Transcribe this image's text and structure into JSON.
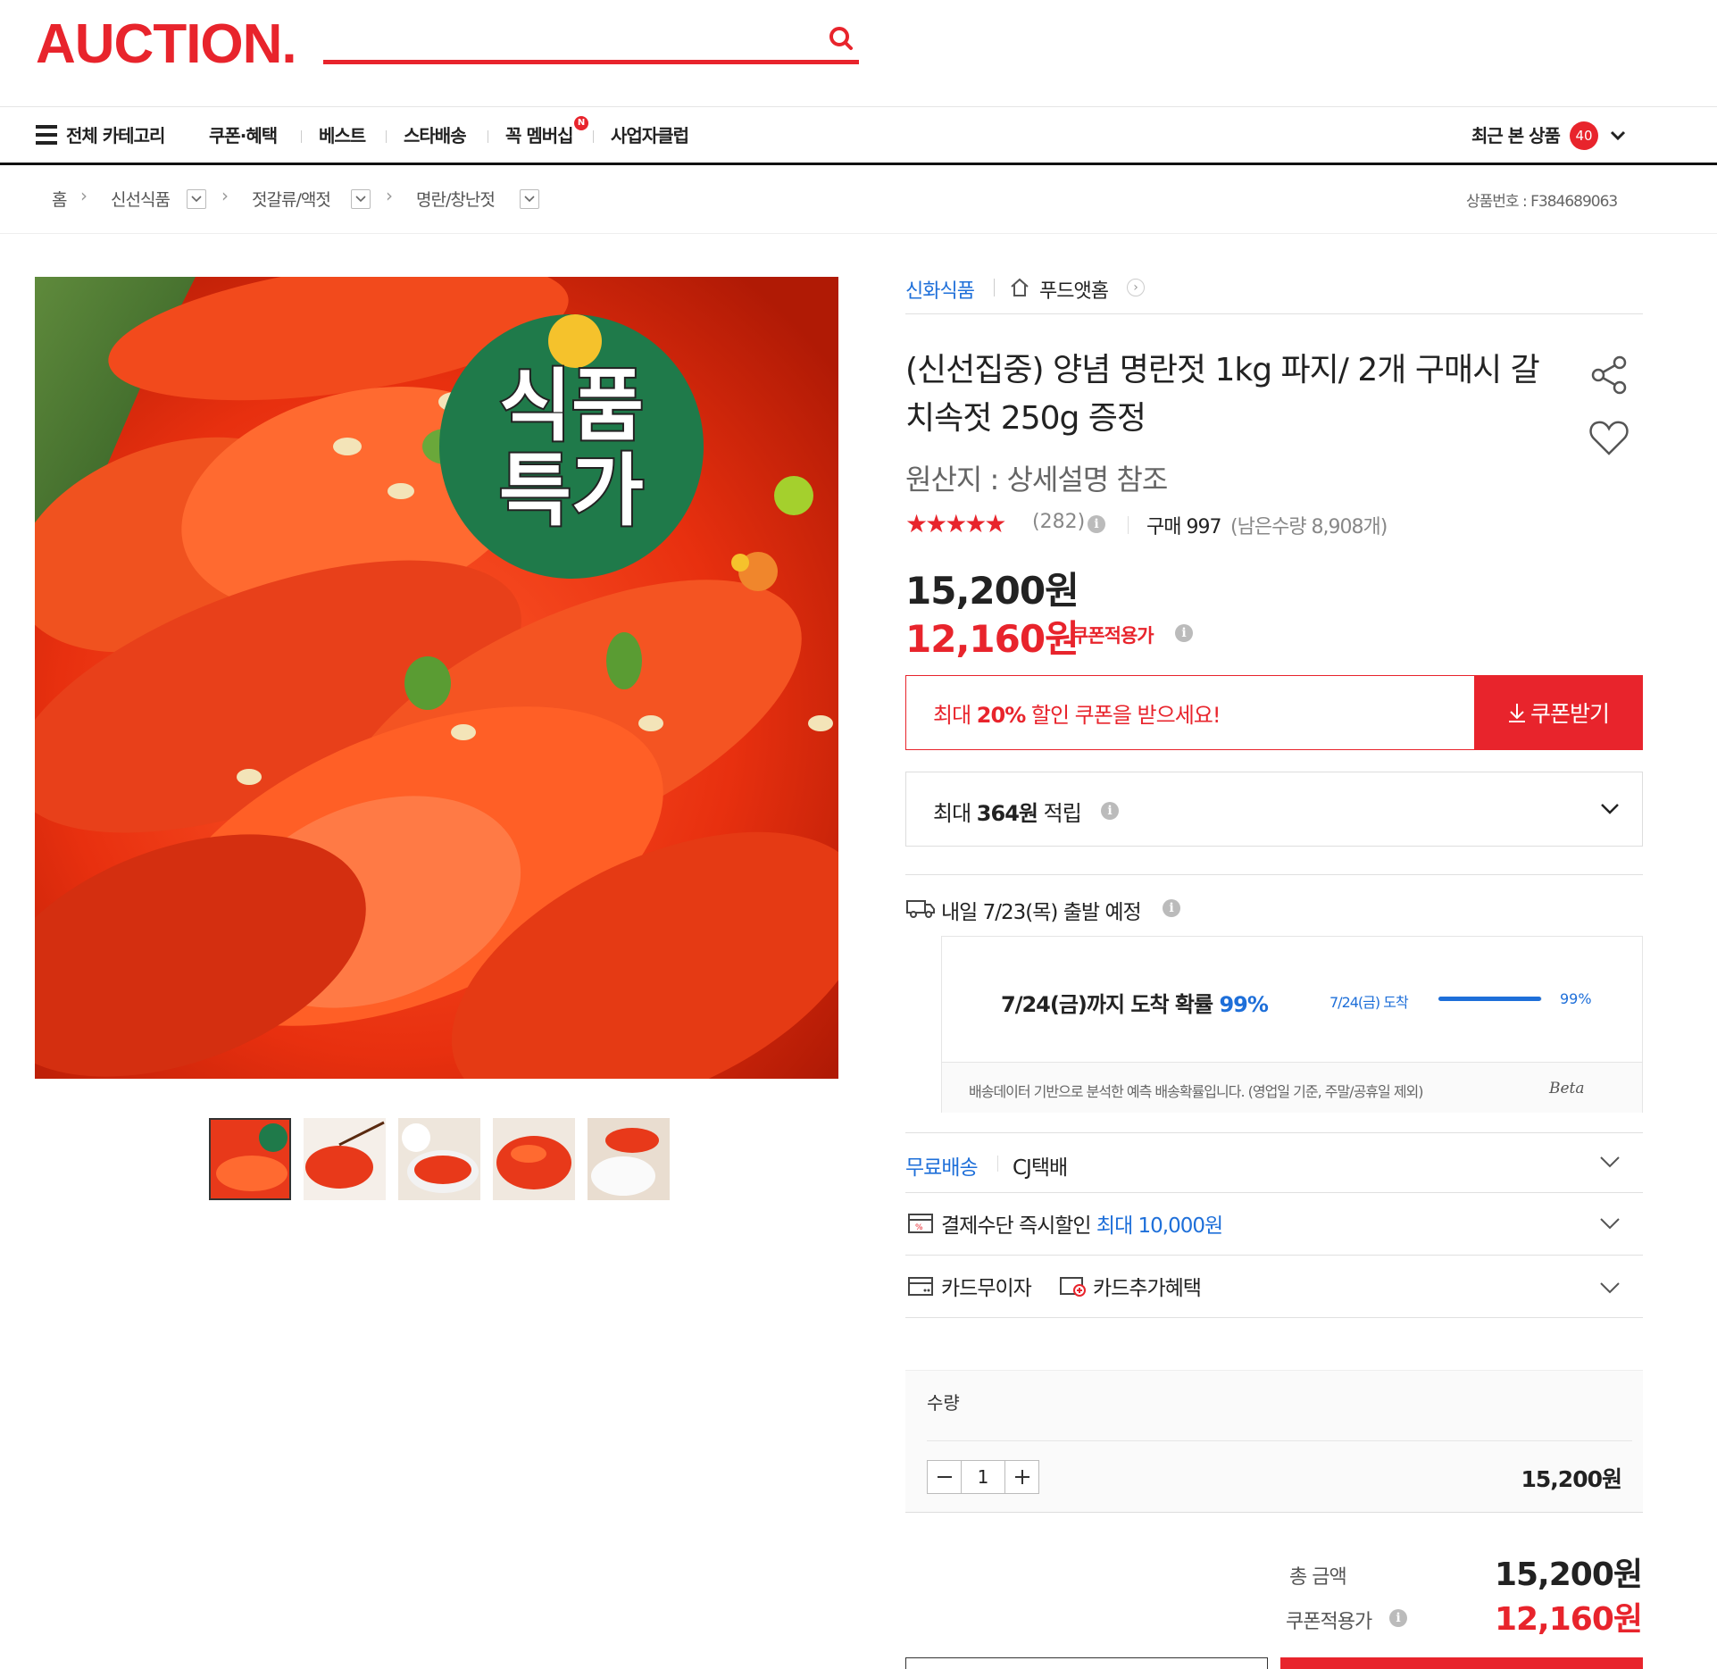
{
  "header": {
    "logo": "AUCTION.",
    "search_placeholder": ""
  },
  "nav": {
    "all_categories": "전체 카테고리",
    "items": [
      "쿠폰·혜택",
      "베스트",
      "스타배송",
      "꼭 멤버십",
      "사업자클럽"
    ],
    "membership_badge": "N",
    "recent_label": "최근 본 상품",
    "recent_count": "40"
  },
  "breadcrumb": {
    "home": "홈",
    "level1": "신선식품",
    "level2": "젓갈류/액젓",
    "level3": "명란/창난젓",
    "product_no": "상품번호 : F384689063"
  },
  "gallery": {
    "badge_line1": "식품",
    "badge_line2": "특가",
    "thumb_count": 5
  },
  "product": {
    "brand": "신화식품",
    "store": "푸드앳홈",
    "title": "(신선집중) 양념 명란젓 1kg 파지/ 2개 구매시 갈치속젓 250g 증정",
    "origin": "원산지 : 상세설명 참조",
    "rating_stars": 4.8,
    "review_count": "(282)",
    "purchase_label": "구매 997",
    "remaining": "(남은수량 8,908개)",
    "price": "15,200원",
    "coupon_price": "12,160원",
    "coupon_price_label": "쿠폰적용가"
  },
  "coupon": {
    "text_prefix": "최대 ",
    "text_percent": "20%",
    "text_suffix": " 할인 쿠폰을 받으세요!",
    "button": "쿠폰받기"
  },
  "points": {
    "prefix": "최대 ",
    "amount": "364원",
    "suffix": " 적립"
  },
  "delivery": {
    "depart": "내일 7/23(목) 출발 예정",
    "prob_text": "7/24(금)까지 도착 확률 ",
    "prob_value": "99%",
    "bar_label": "7/24(금) 도착",
    "bar_value": "99%",
    "bar_fraction": 0.99,
    "note": "배송데이터 기반으로 분석한 예측 배송확률입니다. (영업일 기준, 주말/공휴일 제외)",
    "beta": "Beta"
  },
  "shipping": {
    "free": "무료배송",
    "carrier": "CJ택배"
  },
  "payment": {
    "label": "결제수단 즉시할인 ",
    "highlight": "최대 10,000원"
  },
  "card": {
    "no_interest": "카드무이자",
    "extra": "카드추가혜택"
  },
  "quantity": {
    "label": "수량",
    "value": "1",
    "line_price": "15,200원"
  },
  "total": {
    "label": "총 금액",
    "amount": "15,200원",
    "coupon_label": "쿠폰적용가",
    "coupon_amount": "12,160원"
  },
  "colors": {
    "brand_red": "#e8242c",
    "blue": "#1e6fd9"
  }
}
